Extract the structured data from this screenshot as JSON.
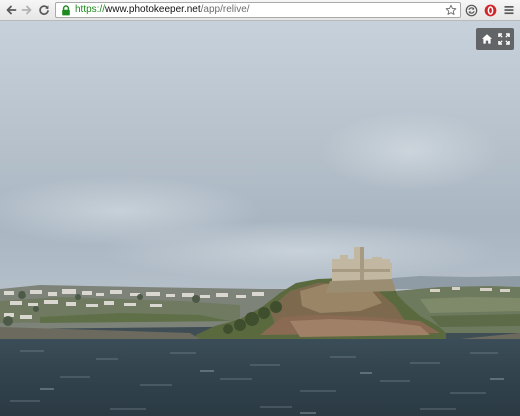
{
  "browser": {
    "url": {
      "scheme": "https://",
      "host": "www.photokeeper.net",
      "path": "/app/relive/"
    },
    "icons": {
      "back": "back-arrow-icon",
      "forward": "forward-arrow-icon",
      "reload": "reload-icon",
      "lock": "lock-icon",
      "bookmark": "star-icon",
      "sync": "sync-icon",
      "extension": "opera-extension-icon",
      "menu": "hamburger-menu-icon"
    },
    "colors": {
      "secure": "#1c8a1c",
      "extension": "#d0262a"
    }
  },
  "viewer": {
    "photo_description_icon": "photo",
    "controls": {
      "home": "home-icon",
      "fullscreen": "fullscreen-icon"
    }
  }
}
